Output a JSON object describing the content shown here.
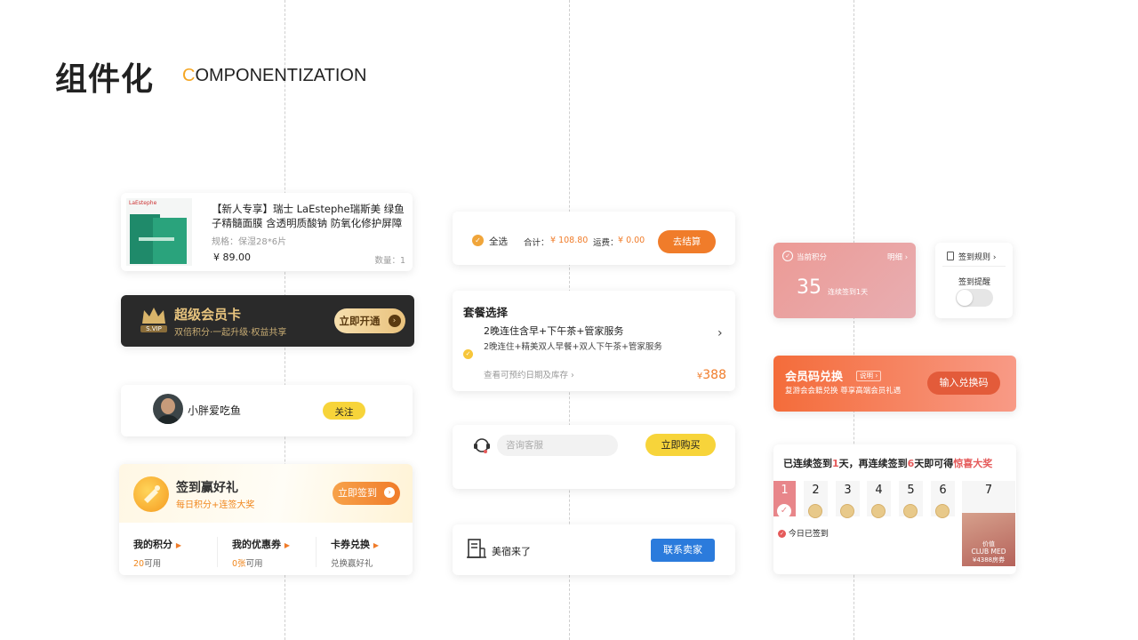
{
  "header": {
    "title_cn": "组件化",
    "title_en_first": "C",
    "title_en_rest": "OMPONENTIZATION"
  },
  "product": {
    "title": "【新人专享】瑞士 LaEstephe瑞斯美 绿鱼子精髓面膜 含透明质酸钠 防氧化修护屏障",
    "spec": "规格：保湿28*6片",
    "price": "¥ 89.00",
    "qty": "数量：1",
    "brand": "LaEstephe"
  },
  "vip": {
    "badge": "S.VIP",
    "title": "超级会员卡",
    "subtitle": "双倍积分·一起升级·权益共享",
    "button": "立即开通"
  },
  "follow": {
    "username": "小胖爱吃鱼",
    "button": "关注"
  },
  "signin": {
    "title": "签到赢好礼",
    "subtitle": "每日积分+连签大奖",
    "button": "立即签到",
    "stats": [
      {
        "label": "我的积分",
        "value": "20",
        "suffix": "可用"
      },
      {
        "label": "我的优惠券",
        "value": "0张",
        "suffix": "可用"
      },
      {
        "label": "卡券兑换",
        "value": "",
        "suffix": "兑换赢好礼"
      }
    ]
  },
  "checkout": {
    "select_all": "全选",
    "total_label": "合计：",
    "total": "¥ 108.80",
    "shipping_label": "运费：",
    "shipping": "¥ 0.00",
    "button": "去结算"
  },
  "package": {
    "title": "套餐选择",
    "option_title": "2晚连住含早+下午茶+管家服务",
    "option_desc": "2晚连住+精美双人早餐+双人下午茶+管家服务",
    "link": "查看可预约日期及库存",
    "price_symbol": "¥",
    "price": "388"
  },
  "service": {
    "placeholder": "咨询客服",
    "button": "立即购买"
  },
  "seller": {
    "shop": "美宿来了",
    "button": "联系卖家"
  },
  "points": {
    "label": "当前积分",
    "detail": "明细",
    "value": "35",
    "streak": "连续签到1天"
  },
  "rule": {
    "label": "签到规则",
    "reminder": "签到提醒"
  },
  "member_code": {
    "title": "会员码兑换",
    "tag": "说明",
    "subtitle": "复游会会籍兑换 尊享高端会员礼遇",
    "button": "输入兑换码"
  },
  "streak": {
    "pre": "已连续签到",
    "days_done": "1",
    "mid": "天，再连续签到",
    "days_left": "6",
    "post": "天即可得",
    "prize": "惊喜大奖",
    "days": [
      "1",
      "2",
      "3",
      "4",
      "5",
      "6",
      "7"
    ],
    "today": "今日已签到",
    "prize_card": {
      "line1": "价值",
      "line2": "CLUB MED",
      "line3": "¥4388房券"
    }
  },
  "colors": {
    "accent": "#f5a623",
    "orange": "#f07c2a",
    "blue": "#2b7bdc",
    "pink": "#e8868a",
    "red": "#e55a5a"
  }
}
